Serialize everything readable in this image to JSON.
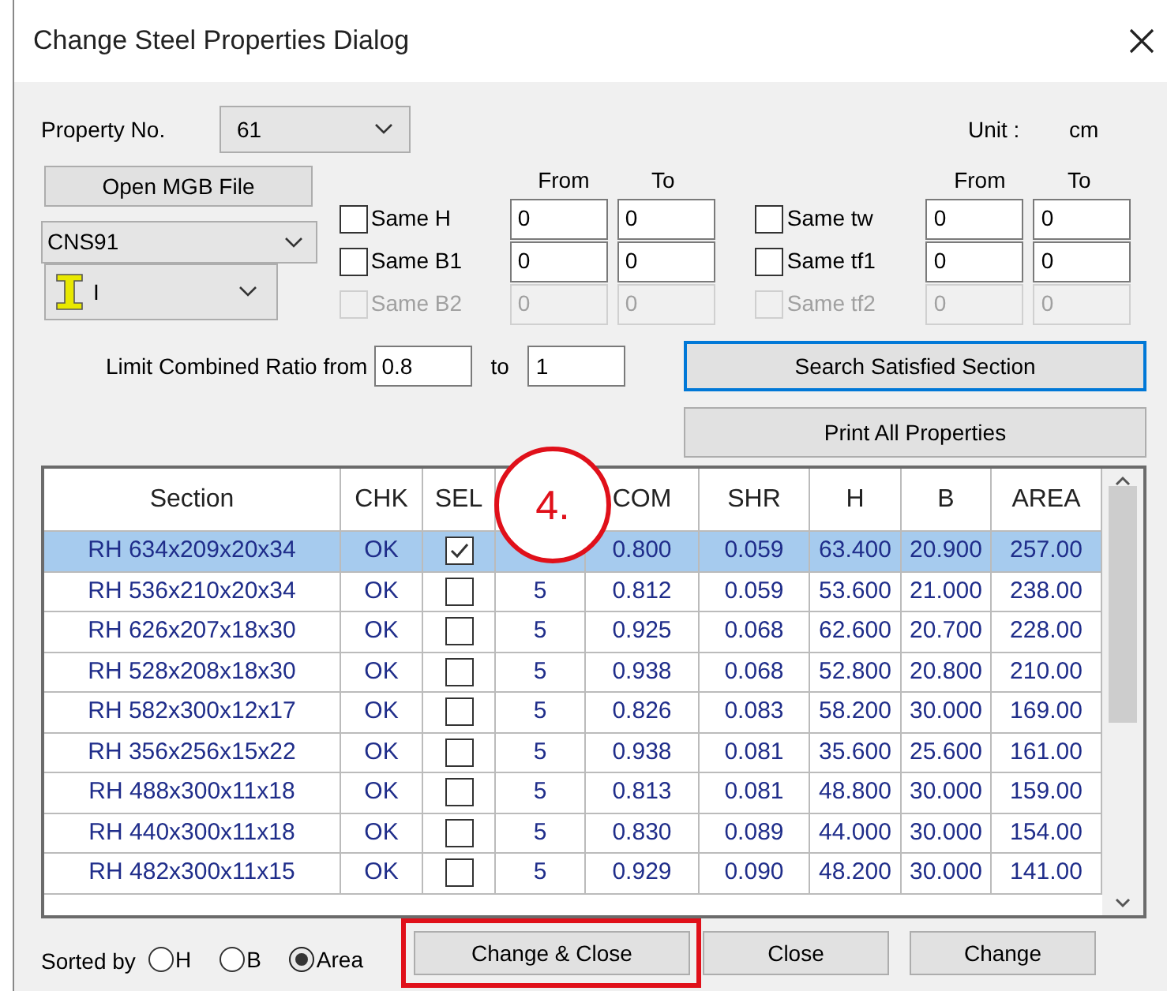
{
  "window": {
    "title": "Change Steel Properties Dialog"
  },
  "property_no": {
    "label": "Property No.",
    "value": "61"
  },
  "unit": {
    "label": "Unit :",
    "value": "cm"
  },
  "open_button": "Open MGB File",
  "standard": {
    "value": "CNS91"
  },
  "shape": {
    "value": "I"
  },
  "filter_groups": [
    {
      "from_label": "From",
      "to_label": "To",
      "rows": [
        {
          "label": "Same H",
          "checked": false,
          "disabled": false,
          "from": "0",
          "to": "0"
        },
        {
          "label": "Same B1",
          "checked": false,
          "disabled": false,
          "from": "0",
          "to": "0"
        },
        {
          "label": "Same B2",
          "checked": false,
          "disabled": true,
          "from": "0",
          "to": "0"
        }
      ]
    },
    {
      "from_label": "From",
      "to_label": "To",
      "rows": [
        {
          "label": "Same tw",
          "checked": false,
          "disabled": false,
          "from": "0",
          "to": "0"
        },
        {
          "label": "Same tf1",
          "checked": false,
          "disabled": false,
          "from": "0",
          "to": "0"
        },
        {
          "label": "Same tf2",
          "checked": false,
          "disabled": true,
          "from": "0",
          "to": "0"
        }
      ]
    }
  ],
  "limit": {
    "label": "Limit Combined Ratio from",
    "from": "0.8",
    "to_label": "to",
    "to": "1"
  },
  "action_buttons": [
    {
      "label": "Search Satisfied Section",
      "focused": true
    },
    {
      "label": "Print All Properties",
      "focused": false
    }
  ],
  "table": {
    "columns": [
      "Section",
      "CHK",
      "SEL",
      "COM",
      "SHR",
      "H",
      "B",
      "AREA"
    ],
    "rows": [
      {
        "section": "RH 634x209x20x34",
        "chk": "OK",
        "checked": true,
        "selected": true,
        "com": "0.800",
        "shr": "0.059",
        "h": "63.400",
        "b": "20.900",
        "area": "257.00"
      },
      {
        "section": "RH 536x210x20x34",
        "chk": "OK",
        "checked": false,
        "selected": false,
        "column_4": "5",
        "com": "0.812",
        "shr": "0.059",
        "h": "53.600",
        "b": "21.000",
        "area": "238.00"
      },
      {
        "section": "RH 626x207x18x30",
        "chk": "OK",
        "checked": false,
        "selected": false,
        "column_4": "5",
        "com": "0.925",
        "shr": "0.068",
        "h": "62.600",
        "b": "20.700",
        "area": "228.00"
      },
      {
        "section": "RH 528x208x18x30",
        "chk": "OK",
        "checked": false,
        "selected": false,
        "column_4": "5",
        "com": "0.938",
        "shr": "0.068",
        "h": "52.800",
        "b": "20.800",
        "area": "210.00"
      },
      {
        "section": "RH 582x300x12x17",
        "chk": "OK",
        "checked": false,
        "selected": false,
        "column_4": "5",
        "com": "0.826",
        "shr": "0.083",
        "h": "58.200",
        "b": "30.000",
        "area": "169.00"
      },
      {
        "section": "RH 356x256x15x22",
        "chk": "OK",
        "checked": false,
        "selected": false,
        "column_4": "5",
        "com": "0.938",
        "shr": "0.081",
        "h": "35.600",
        "b": "25.600",
        "area": "161.00"
      },
      {
        "section": "RH 488x300x11x18",
        "chk": "OK",
        "checked": false,
        "selected": false,
        "column_4": "5",
        "com": "0.813",
        "shr": "0.081",
        "h": "48.800",
        "b": "30.000",
        "area": "159.00"
      },
      {
        "section": "RH 440x300x11x18",
        "chk": "OK",
        "checked": false,
        "selected": false,
        "column_4": "5",
        "com": "0.830",
        "shr": "0.089",
        "h": "44.000",
        "b": "30.000",
        "area": "154.00"
      },
      {
        "section": "RH 482x300x11x15",
        "chk": "OK",
        "checked": false,
        "selected": false,
        "column_4": "5",
        "com": "0.929",
        "shr": "0.090",
        "h": "48.200",
        "b": "30.000",
        "area": "141.00"
      }
    ]
  },
  "sort": {
    "label": "Sorted by",
    "options": [
      {
        "label": "H",
        "selected": false
      },
      {
        "label": "B",
        "selected": false
      },
      {
        "label": "Area",
        "selected": true
      }
    ]
  },
  "bottom_buttons": [
    {
      "label": "Change & Close",
      "highlighted": true
    },
    {
      "label": "Close",
      "highlighted": false
    },
    {
      "label": "Change",
      "highlighted": false
    }
  ],
  "annotation": {
    "label": "4."
  }
}
